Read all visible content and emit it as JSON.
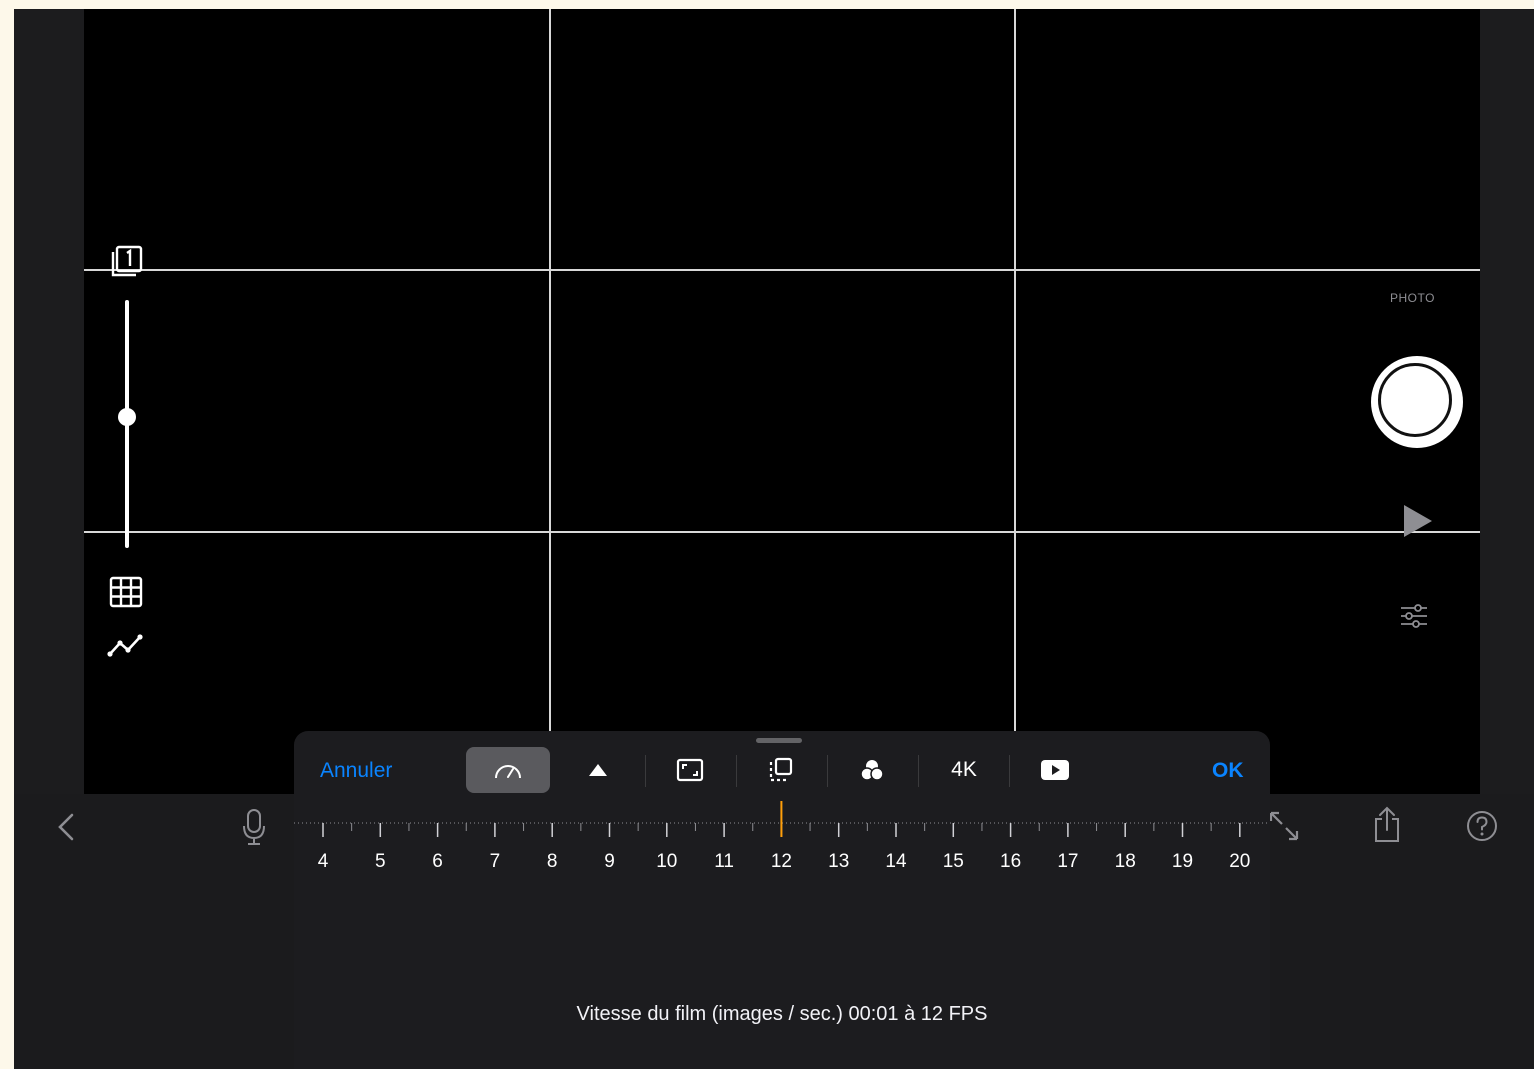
{
  "camera": {
    "mode_label": "PHOTO",
    "exposure_level": 0.5
  },
  "icons": {
    "layers": "layers-icon",
    "grid": "grid-icon",
    "graph": "graph-icon",
    "play": "play-icon",
    "adjust": "sliders-icon",
    "back": "chevron-left-icon",
    "mic": "microphone-icon",
    "expand": "expand-icon",
    "share": "share-icon",
    "help": "help-icon",
    "speed": "speedometer-icon",
    "triangle": "triangle-icon",
    "frame": "frame-icon",
    "stack": "stack-icon",
    "color": "color-filter-icon",
    "video": "video-play-icon"
  },
  "panel": {
    "cancel_label": "Annuler",
    "ok_label": "OK",
    "resolution_label": "4K",
    "ruler": {
      "min": 4,
      "max": 20,
      "labels": [
        "4",
        "5",
        "6",
        "7",
        "8",
        "9",
        "10",
        "11",
        "12",
        "13",
        "14",
        "15",
        "16",
        "17",
        "18",
        "19",
        "20"
      ],
      "selected": 12
    },
    "caption": "Vitesse du film (images / sec.) 00:01 à 12 FPS"
  },
  "colors": {
    "accent": "#0a84ff",
    "ruler_indicator": "#ff9f0a"
  }
}
